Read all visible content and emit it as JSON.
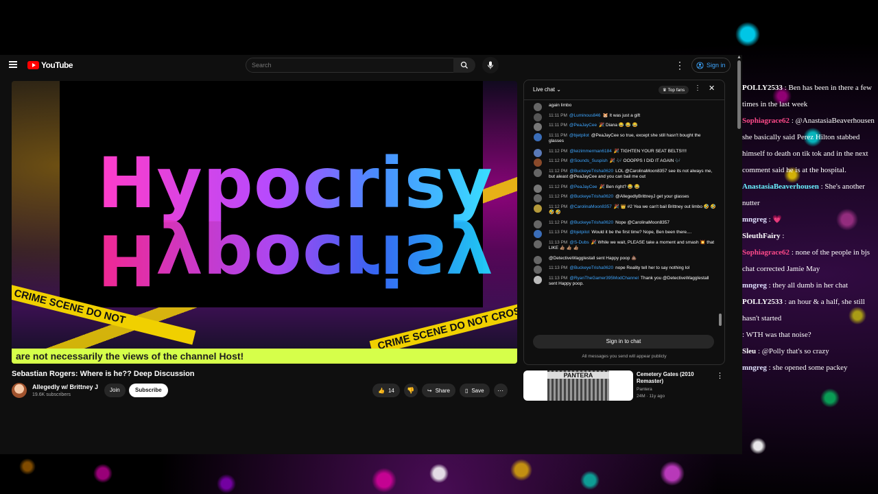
{
  "colors": {
    "accent": "#3ea6ff",
    "brand_red": "#ff0000",
    "ticker": "#d6ff4a"
  },
  "header": {
    "logo_text": "YouTube",
    "search_placeholder": "Search",
    "signin_label": "Sign in"
  },
  "video": {
    "title_text": "Hypocrisy",
    "tape_left": "CRIME SCENE DO NOT",
    "tape_right": "CRIME SCENE DO NOT CROSS",
    "ticker": "are not necessarily the views of the channel Host!"
  },
  "meta": {
    "title": "Sebastian Rogers: Where is he?? Deep Discussion",
    "channel": "Allegedly w/ Brittney J",
    "subscribers": "19.6K subscribers",
    "join_label": "Join",
    "subscribe_label": "Subscribe",
    "like_count": "14",
    "share_label": "Share",
    "save_label": "Save"
  },
  "chat": {
    "title": "Live chat",
    "top_fans": "Top fans",
    "signin_label": "Sign in to chat",
    "note": "All messages you send will appear publicly",
    "messages": [
      {
        "time": "",
        "author": "",
        "text": "again limbo",
        "color": "#666"
      },
      {
        "time": "11:11 PM",
        "author": "@Luminous846",
        "text": "🐹 It was just a gift",
        "color": "#555"
      },
      {
        "time": "11:11 PM",
        "author": "@PeaJayCee",
        "text": "🎉 Diana 😂 😂 😂",
        "color": "#777"
      },
      {
        "time": "11:11 PM",
        "author": "@bjetpilot",
        "text": "@PeaJayCee so true, except she still hasn't bought the glasses",
        "color": "#3a6db8"
      },
      {
        "time": "11:12 PM",
        "author": "@leizimmerman6184",
        "text": "🎉 TIGHTEN YOUR SEAT BELTS!!!!",
        "color": "#5a7ab8"
      },
      {
        "time": "11:12 PM",
        "author": "@Sounds_Suspish",
        "text": "🎉 🎶 OOOPPS I DID IT AGAIN 🎶",
        "color": "#8a4a2a"
      },
      {
        "time": "11:12 PM",
        "author": "@BuckeyeTrisha0620",
        "text": "LOL @CarolinaMoon8357 see its not always me, but aleast @PeaJayCee and you can bail me out",
        "color": "#666"
      },
      {
        "time": "11:12 PM",
        "author": "@PeaJayCee",
        "text": "🎉 Ben right? 😂 😂",
        "color": "#777"
      },
      {
        "time": "11:12 PM",
        "author": "@BuckeyeTrisha0620",
        "text": "@AllegedlyBrittneyJ get your glasses",
        "color": "#666"
      },
      {
        "time": "11:12 PM",
        "author": "@CarolinaMoon8357",
        "text": "🎉 👑 #2 Yea we can't bail Brittney out limbo 🤣 🤣 🤣 🤣",
        "color": "#b59a3a"
      },
      {
        "time": "11:12 PM",
        "author": "@BuckeyeTrisha0620",
        "text": "Nope @CarolinaMoon8357",
        "color": "#666"
      },
      {
        "time": "11:13 PM",
        "author": "@bjetpilot",
        "text": "Would it be the first time? Nope, Ben been there....",
        "color": "#3a6db8"
      },
      {
        "time": "11:13 PM",
        "author": "@S-Dubs",
        "text": "🎉 While we wait, PLEASE take a moment and smash 💥 that LIKE 👍🏽 👍🏽 👍🏽",
        "color": "#666"
      },
      {
        "time": "",
        "author": "",
        "text": "@DetectiveWaggIestall sent Happy poop 💩",
        "color": "#666"
      },
      {
        "time": "11:13 PM",
        "author": "@BuckeyeTrisha0620",
        "text": "nope Reality tell her to say nothing lol",
        "color": "#666"
      },
      {
        "time": "11:13 PM",
        "author": "@RyanTheGamer395ModChannel",
        "text": "Thank you @DetectiveWaggIestall sent Happy poop.",
        "color": "#bbb"
      }
    ]
  },
  "recommendation": {
    "thumb_text": "PANTERA",
    "title": "Cemetery Gates (2010 Remaster)",
    "channel": "Pantera",
    "meta": "24M · 11y ago"
  },
  "overlay_chat": [
    {
      "name": "POLLY2533",
      "name_color": "#ffffff",
      "text": ": Ben has been in there a few times in the last week"
    },
    {
      "name": "Sophiagrace62",
      "name_color": "#ff4a8a",
      "text": ": @AnastasiaBeaverhousen she basically said Perez Hilton stabbed himself to death on tik tok and in the next comment said he is at the hospital."
    },
    {
      "name": "AnastasiaBeaverhousen",
      "name_color": "#6af0ff",
      "text": ": She's another nutter"
    },
    {
      "name": "mngreg",
      "name_color": "#e0e0ff",
      "text": ": 💗"
    },
    {
      "name": "SleuthFairy",
      "name_color": "#ffffff",
      "text": ":"
    },
    {
      "name": "Sophiagrace62",
      "name_color": "#ff4a8a",
      "text": ": none of the people in bjs chat corrected Jamie May"
    },
    {
      "name": "mngreg",
      "name_color": "#e0e0ff",
      "text": ": they all dumb in her chat"
    },
    {
      "name": "POLLY2533",
      "name_color": "#ffffff",
      "text": ": an hour & a half, she still hasn't started"
    },
    {
      "name": "",
      "name_color": "#ffffff",
      "text": ": WTH was that noise?"
    },
    {
      "name": "Sleu",
      "name_color": "#ffffff",
      "text": ": @Polly that's so crazy"
    },
    {
      "name": "mngreg",
      "name_color": "#e0e0ff",
      "text": ": she opened some packey"
    }
  ]
}
